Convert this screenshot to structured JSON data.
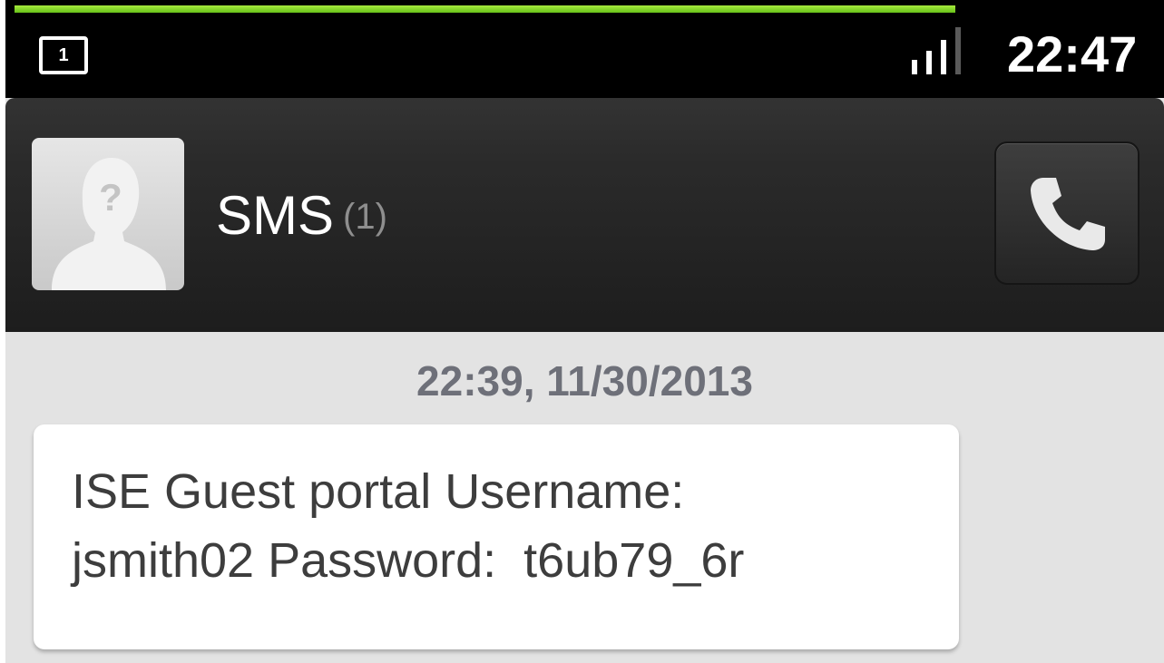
{
  "status_bar": {
    "notification_count": "1",
    "time": "22:47"
  },
  "header": {
    "title": "SMS",
    "count": "(1)",
    "avatar_placeholder": "?"
  },
  "conversation": {
    "timestamp": "22:39, 11/30/2013",
    "messages": [
      {
        "lines": [
          "ISE Guest portal Username:",
          "jsmith02 Password:  t6ub79_6r"
        ]
      }
    ]
  },
  "icons": {
    "avatar": "unknown-person-icon",
    "call": "phone-handset-icon",
    "signal": "signal-strength-icon",
    "notification": "notification-count-icon"
  },
  "colors": {
    "accent_green": "#7fd422",
    "header_bg": "#232323",
    "timestamp_text": "#6e7079"
  }
}
